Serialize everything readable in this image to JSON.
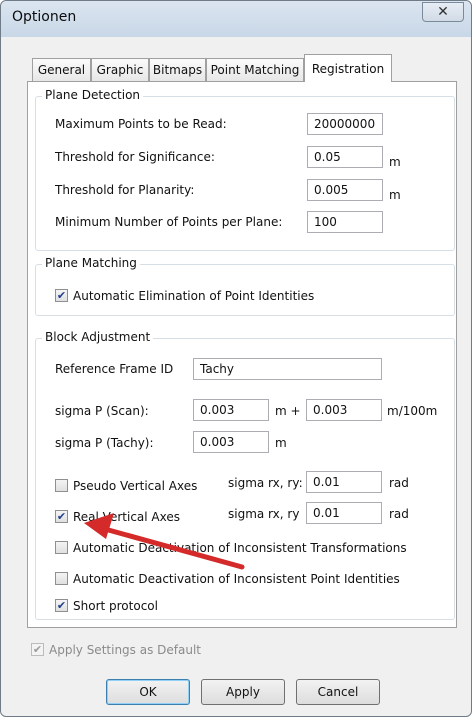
{
  "window": {
    "title": "Optionen",
    "close_glyph": "✕"
  },
  "tabs": [
    "General",
    "Graphic",
    "Bitmaps",
    "Point Matching",
    "Registration"
  ],
  "plane_detection": {
    "title": "Plane Detection",
    "rows": [
      {
        "label": "Maximum Points to be Read:",
        "value": "20000000",
        "unit": ""
      },
      {
        "label": "Threshold for Significance:",
        "value": "0.05",
        "unit": "m"
      },
      {
        "label": "Threshold for Planarity:",
        "value": "0.005",
        "unit": "m"
      },
      {
        "label": "Minimum Number of Points per Plane:",
        "value": "100",
        "unit": ""
      }
    ]
  },
  "plane_matching": {
    "title": "Plane Matching",
    "auto_elim": {
      "label": "Automatic Elimination of Point Identities",
      "checked": true
    }
  },
  "block_adjustment": {
    "title": "Block Adjustment",
    "ref_frame_label": "Reference Frame ID",
    "ref_frame_value": "Tachy",
    "sigma_scan_label": "sigma P (Scan):",
    "sigma_scan_value1": "0.003",
    "sigma_scan_mid": "m +",
    "sigma_scan_value2": "0.003",
    "sigma_scan_unit": "m/100m",
    "sigma_tachy_label": "sigma P (Tachy):",
    "sigma_tachy_value": "0.003",
    "sigma_tachy_unit": "m",
    "pseudo_vertical": {
      "label": "Pseudo Vertical Axes",
      "checked": false,
      "sigma_label": "sigma rx, ry:",
      "sigma_value": "0.01",
      "unit": "rad"
    },
    "real_vertical": {
      "label": "Real Vertical Axes",
      "checked": true,
      "sigma_label": "sigma rx, ry",
      "sigma_value": "0.01",
      "unit": "rad"
    },
    "auto_deact_transform": {
      "label": "Automatic Deactivation of Inconsistent Transformations",
      "checked": false
    },
    "auto_deact_points": {
      "label": "Automatic Deactivation of Inconsistent Point Identities",
      "checked": false
    },
    "short_protocol": {
      "label": "Short protocol",
      "checked": true
    }
  },
  "apply_default": {
    "label": "Apply Settings as Default",
    "checked": true,
    "enabled": false
  },
  "buttons": {
    "ok": "OK",
    "apply": "Apply",
    "cancel": "Cancel"
  },
  "annotation": {
    "arrow_color": "#d42a2a"
  },
  "colors": {
    "check_mark": "#1f3f8c",
    "group_border": "#d5dfe5",
    "titlebar": "#c8d7e7"
  }
}
